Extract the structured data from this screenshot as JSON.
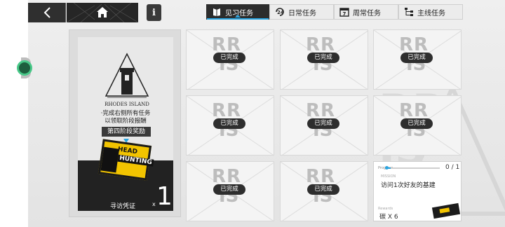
{
  "colors": {
    "accent": "#2aa4e0",
    "dark": "#2c2c2c",
    "ticket_yellow": "#f2c400"
  },
  "topbar": {
    "back_icon": "back-arrow-icon",
    "home_icon": "home-icon",
    "info_label": "i"
  },
  "tabs": [
    {
      "label": "见习任务",
      "icon": "book-icon",
      "active": true
    },
    {
      "label": "日常任务",
      "icon": "24h-clock-icon",
      "active": false
    },
    {
      "label": "周常任务",
      "icon": "calendar-7-icon",
      "active": false
    },
    {
      "label": "主线任务",
      "icon": "tree-icon",
      "active": false
    }
  ],
  "stage_panel": {
    "logo_text": "RHODES ISLAND",
    "instruction_line1": "·完成右侧所有任务",
    "instruction_line2": "以领取阶段报酬",
    "stage_label": "第四阶段奖励",
    "ticket_text1": "HEAD",
    "ticket_text2": "HUNTING",
    "reward_name": "寻访凭证",
    "reward_x": "x",
    "reward_count": "1"
  },
  "grid": {
    "completed_label": "已完成",
    "watermark_line1": "RR",
    "watermark_line2": "IS"
  },
  "active_task": {
    "progress_label": "Progress",
    "progress_text": "0 / 1",
    "progress_fraction": 0,
    "sub_label": "MISSION",
    "description": "访问1次好友的基建",
    "reward_label": "Rewards",
    "reward_text": "碳 X 6"
  }
}
